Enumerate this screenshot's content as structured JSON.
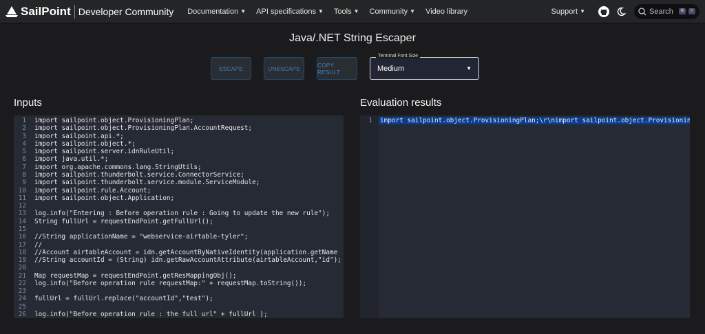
{
  "nav": {
    "logo": "SailPoint",
    "brand": "Developer Community",
    "links": [
      {
        "label": "Documentation"
      },
      {
        "label": "API specifications"
      },
      {
        "label": "Tools"
      },
      {
        "label": "Community"
      },
      {
        "label": "Video library"
      }
    ],
    "support": "Support",
    "search_placeholder": "Search",
    "kbd": [
      "⌘",
      "K"
    ]
  },
  "page": {
    "title": "Java/.NET String Escaper"
  },
  "toolbar": {
    "escape": "ESCAPE",
    "unescape": "UNESCAPE",
    "copy": "COPY RESULT",
    "font_size_label": "Terminal Font Size",
    "font_size_value": "Medium"
  },
  "inputs": {
    "heading": "Inputs",
    "lines": [
      "import sailpoint.object.ProvisioningPlan;",
      "import sailpoint.object.ProvisioningPlan.AccountRequest;",
      "import sailpoint.api.*;",
      "import sailpoint.object.*;",
      "import sailpoint.server.idnRuleUtil;",
      "import java.util.*;",
      "import org.apache.commons.lang.StringUtils;",
      "import sailpoint.thunderbolt.service.ConnectorService;",
      "import sailpoint.thunderbolt.service.module.ServiceModule;",
      "import sailpoint.rule.Account;",
      "import sailpoint.object.Application;",
      "",
      "log.info(\"Entering : Before operation rule : Going to update the new rule\");",
      "String fullUrl = requestEndPoint.getFullUrl();",
      "",
      "//String applicationName = \"webservice-airtable-tyler\";",
      "//",
      "//Account airtableAccount = idn.getAccountByNativeIdentity(application.getName",
      "//String accountId = (String) idn.getRawAccountAttribute(airtableAccount,\"id\");",
      "",
      "Map requestMap = requestEndPoint.getResMappingObj();",
      "log.info(\"Before operation rule requestMap:\" + requestMap.toString());",
      "",
      "fullUrl = fullUrl.replace(\"accountId\",\"test\");",
      "",
      "log.info(\"Before operation rule : the full url\" + fullUrl );"
    ]
  },
  "results": {
    "heading": "Evaluation results",
    "lines": [
      "import sailpoint.object.ProvisioningPlan;\\r\\nimport sailpoint.object.ProvisioningPlan.AccountRequest;"
    ]
  }
}
